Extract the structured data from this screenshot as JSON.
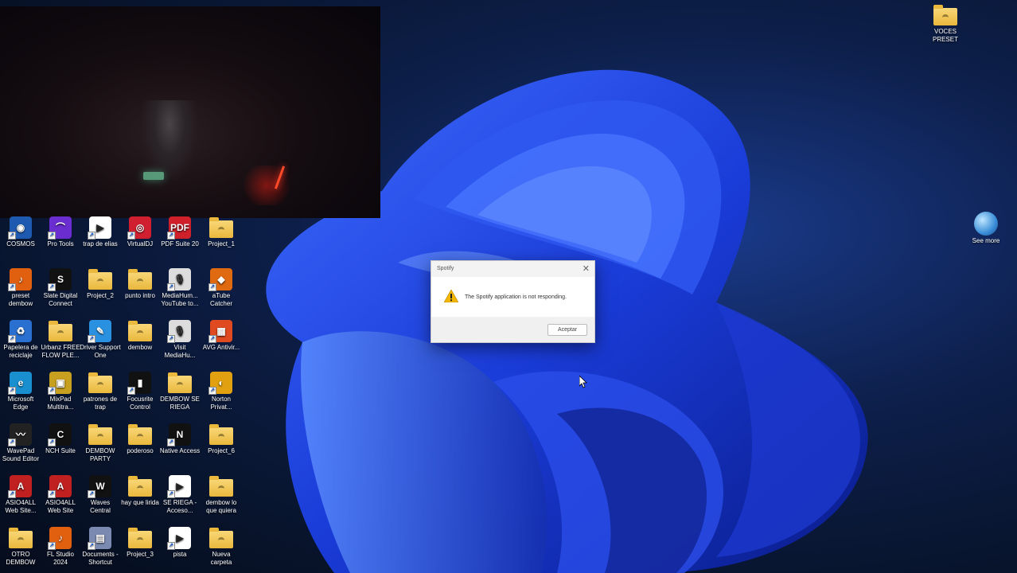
{
  "desktop_icons": [
    {
      "label": "COSMOS",
      "kind": "app",
      "color": "#1e5bb0",
      "glyph": "◉"
    },
    {
      "label": "Pro Tools",
      "kind": "app",
      "color": "#6a2dd0",
      "glyph": "⌒"
    },
    {
      "label": "trap de elias",
      "kind": "app",
      "color": "#ffffff",
      "glyph": "▶"
    },
    {
      "label": "VirtualDJ",
      "kind": "app",
      "color": "#d02030",
      "glyph": "◎"
    },
    {
      "label": "PDF Suite 20",
      "kind": "app",
      "color": "#d0202a",
      "glyph": "PDF"
    },
    {
      "label": "Project_1",
      "kind": "folder"
    },
    {
      "label": "preset dembow",
      "kind": "app",
      "color": "#e06010",
      "glyph": "♪"
    },
    {
      "label": "Slate Digital Connect",
      "kind": "app",
      "color": "#111111",
      "glyph": "S"
    },
    {
      "label": "Project_2",
      "kind": "folder"
    },
    {
      "label": "punto intro",
      "kind": "folder"
    },
    {
      "label": "MediaHum... YouTube to...",
      "kind": "app",
      "color": "#dddddd",
      "glyph": "🎙"
    },
    {
      "label": "aTube Catcher",
      "kind": "app",
      "color": "#e06a10",
      "glyph": "◆"
    },
    {
      "label": "Papelera de reciclaje",
      "kind": "app",
      "color": "#2a70d0",
      "glyph": "♻"
    },
    {
      "label": "Urbanz FREE FLOW PLE...",
      "kind": "folder"
    },
    {
      "label": "Driver Support One",
      "kind": "app",
      "color": "#2a90e0",
      "glyph": "✎"
    },
    {
      "label": "dembow",
      "kind": "folder"
    },
    {
      "label": "Visit MediaHu...",
      "kind": "app",
      "color": "#dddddd",
      "glyph": "🎙"
    },
    {
      "label": "AVG Antivir...",
      "kind": "app",
      "color": "#e04a20",
      "glyph": "▦"
    },
    {
      "label": "Microsoft Edge",
      "kind": "app",
      "color": "#1a8fd0",
      "glyph": "e"
    },
    {
      "label": "MixPad Multitra...",
      "kind": "app",
      "color": "#c8a020",
      "glyph": "▣"
    },
    {
      "label": "patrones de trap",
      "kind": "folder"
    },
    {
      "label": "Focusrite Control",
      "kind": "app",
      "color": "#111111",
      "glyph": "▮"
    },
    {
      "label": "DEMBOW SE RIEGA",
      "kind": "folder"
    },
    {
      "label": "Norton Privat...",
      "kind": "app",
      "color": "#e0a010",
      "glyph": "◐"
    },
    {
      "label": "WavePad Sound Editor",
      "kind": "app",
      "color": "#222222",
      "glyph": "〰"
    },
    {
      "label": "NCH Suite",
      "kind": "app",
      "color": "#111111",
      "glyph": "C"
    },
    {
      "label": "DEMBOW PARTY",
      "kind": "folder"
    },
    {
      "label": "poderoso",
      "kind": "folder"
    },
    {
      "label": "Native Access",
      "kind": "app",
      "color": "#111111",
      "glyph": "N"
    },
    {
      "label": "Project_6",
      "kind": "folder"
    },
    {
      "label": "ASIO4ALL Web Site...",
      "kind": "app",
      "color": "#c02020",
      "glyph": "A"
    },
    {
      "label": "ASIO4ALL Web Site",
      "kind": "app",
      "color": "#c02020",
      "glyph": "A"
    },
    {
      "label": "Waves Central",
      "kind": "app",
      "color": "#111111",
      "glyph": "W"
    },
    {
      "label": "hay que lirida",
      "kind": "folder"
    },
    {
      "label": "SE RIEGA - Acceso...",
      "kind": "app",
      "color": "#ffffff",
      "glyph": "▶"
    },
    {
      "label": "dembow lo que quiera",
      "kind": "folder"
    },
    {
      "label": "OTRO DEMBOW",
      "kind": "folder"
    },
    {
      "label": "FL Studio 2024",
      "kind": "app",
      "color": "#e06010",
      "glyph": "♪"
    },
    {
      "label": "Documents - Shortcut",
      "kind": "app",
      "color": "#7a8ab0",
      "glyph": "▤"
    },
    {
      "label": "Project_3",
      "kind": "folder"
    },
    {
      "label": "pista",
      "kind": "app",
      "color": "#ffffff",
      "glyph": "▶"
    },
    {
      "label": "Nueva carpeta",
      "kind": "folder"
    }
  ],
  "right_icons": {
    "voces": "VOCES PRESET",
    "see_more": "See more"
  },
  "dialog": {
    "title": "Spotify",
    "message": "The Spotify application is not responding.",
    "ok_label": "Aceptar",
    "close_glyph": "✕"
  }
}
